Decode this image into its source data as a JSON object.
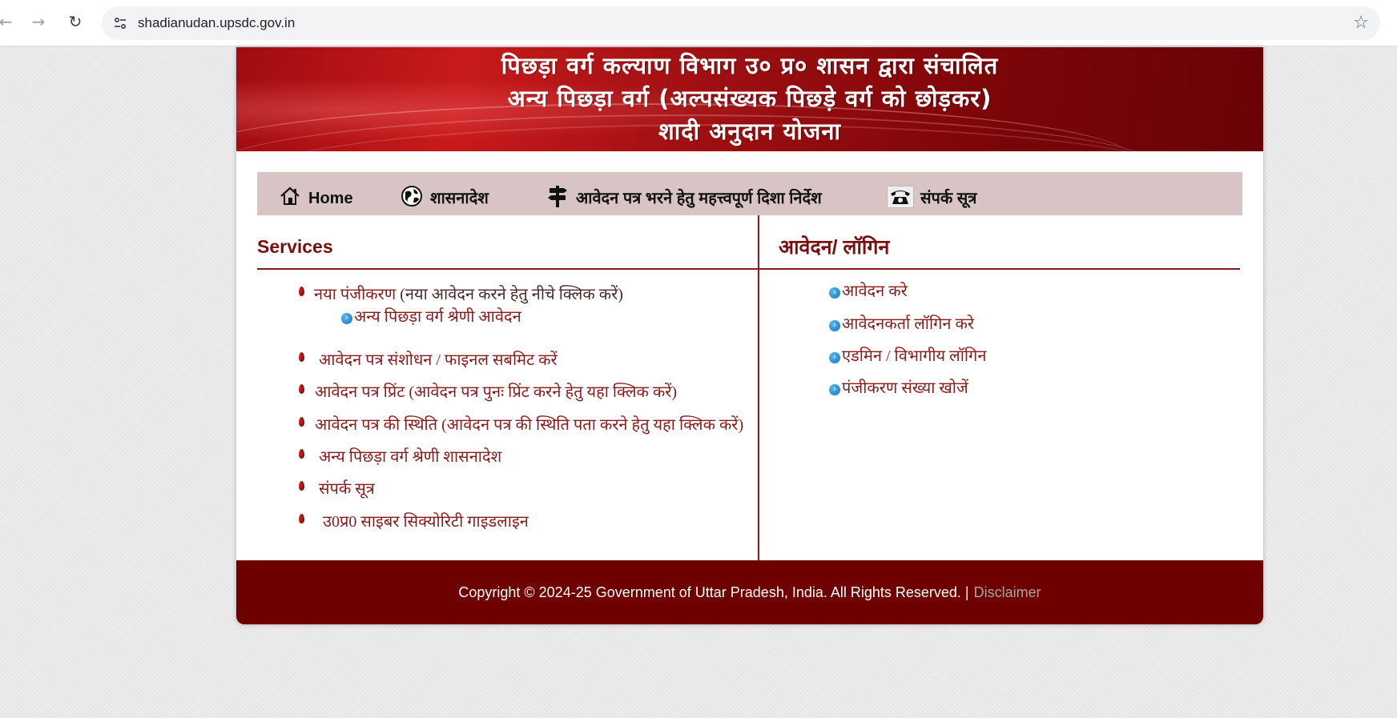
{
  "browser": {
    "url": "shadianudan.upsdc.gov.in"
  },
  "banner": {
    "line1": "पिछड़ा  वर्ग कल्याण विभाग उ० प्र० शासन द्वारा संचालित",
    "line2": "अन्य पिछड़ा वर्ग (अल्पसंख्यक पिछड़े वर्ग को छोड़कर)",
    "line3": "शादी अनुदान योजना"
  },
  "menu": {
    "home": "Home",
    "shasanadesh": "शासनादेश",
    "guidelines": "आवेदन पत्र भरने हेतु महत्त्वपूर्ण दिशा निर्देश",
    "contact": "संपर्क सूत्र"
  },
  "services": {
    "heading": "Services",
    "new_registration_main": "नया पंजीकरण",
    "new_registration_note": "(नया आवेदन करने हेतु नीचे क्लिक करें)",
    "obc_application": "अन्य पिछड़ा वर्ग श्रेणी आवेदन",
    "edit_final_submit": "आवेदन पत्र संशोधन / फाइनल सबमिट करें",
    "print_main": "आवेदन पत्र प्रिंट",
    "print_note": "(आवेदन पत्र पुनः प्रिंट करने हेतु यहा क्लिक करें)",
    "status_main": "आवेदन पत्र की स्थिति",
    "status_note": "(आवेदन पत्र की स्थिति पता करने हेतु यहा क्लिक करें)",
    "obc_shasanadesh": "अन्य पिछड़ा वर्ग श्रेणी शासनादेश",
    "contact": "संपर्क सूत्र",
    "cyber_security": "उ0प्र0 साइबर सिक्योरिटी गाइडलाइन"
  },
  "login": {
    "heading": "आवेदन/ लॉगिन",
    "apply": "आवेदन करे",
    "applicant_login": "आवेदनकर्ता लॉगिन करे",
    "admin_login": "एडमिन / विभागीय लॉगिन",
    "search_registration": "पंजीकरण संख्या खोजें"
  },
  "footer": {
    "copyright": "Copyright © 2024-25 Government of Uttar Pradesh, India. All Rights Reserved. |",
    "disclaimer": "Disclaimer"
  },
  "icons": {
    "back": "←",
    "forward": "→",
    "reload": "↻",
    "star": "☆",
    "home": "⌂",
    "blue_bullet": "›"
  }
}
